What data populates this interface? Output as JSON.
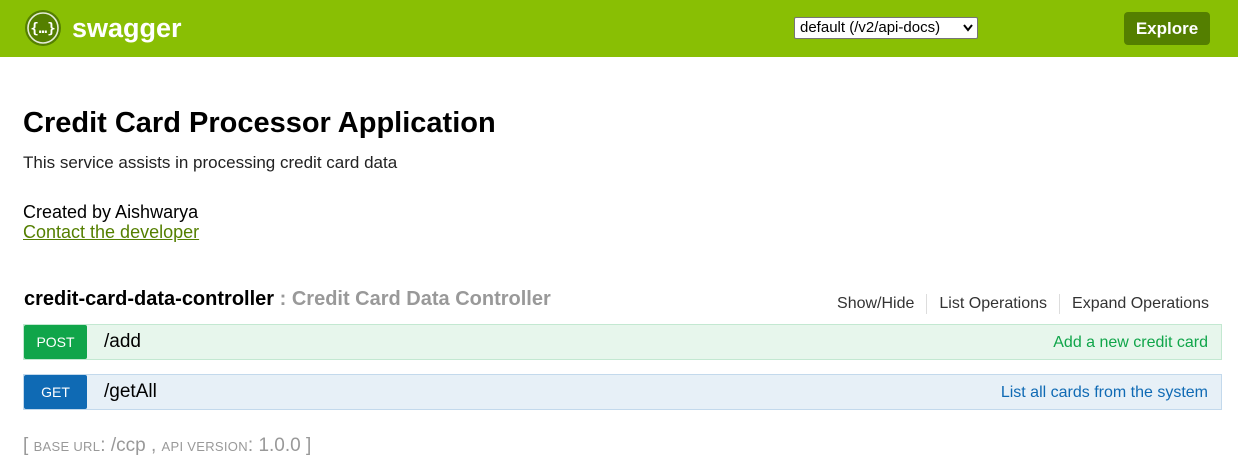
{
  "header": {
    "brand": "swagger",
    "logo_icon": "swagger-braces-icon",
    "spec_selected": "default (/v2/api-docs)",
    "explore_label": "Explore",
    "colors": {
      "bar": "#89bf04",
      "button": "#547f00"
    }
  },
  "info": {
    "title": "Credit Card Processor Application",
    "description": "This service assists in processing credit card data",
    "created_by": "Created by Aishwarya",
    "contact_link": "Contact the developer"
  },
  "controller": {
    "name": "credit-card-data-controller",
    "separator": " : ",
    "description": "Credit Card Data Controller",
    "links": [
      "Show/Hide",
      "List Operations",
      "Expand Operations"
    ]
  },
  "operations": [
    {
      "method": "POST",
      "path": "/add",
      "summary": "Add a new credit card",
      "color": "#10a54a"
    },
    {
      "method": "GET",
      "path": "/getAll",
      "summary": "List all cards from the system",
      "color": "#0f6ab4"
    }
  ],
  "footer": {
    "open": "[ ",
    "base_url_label": "Base URL",
    "base_url_value": ": /ccp , ",
    "api_version_label": "Api Version",
    "api_version_value": ": 1.0.0 ]"
  }
}
